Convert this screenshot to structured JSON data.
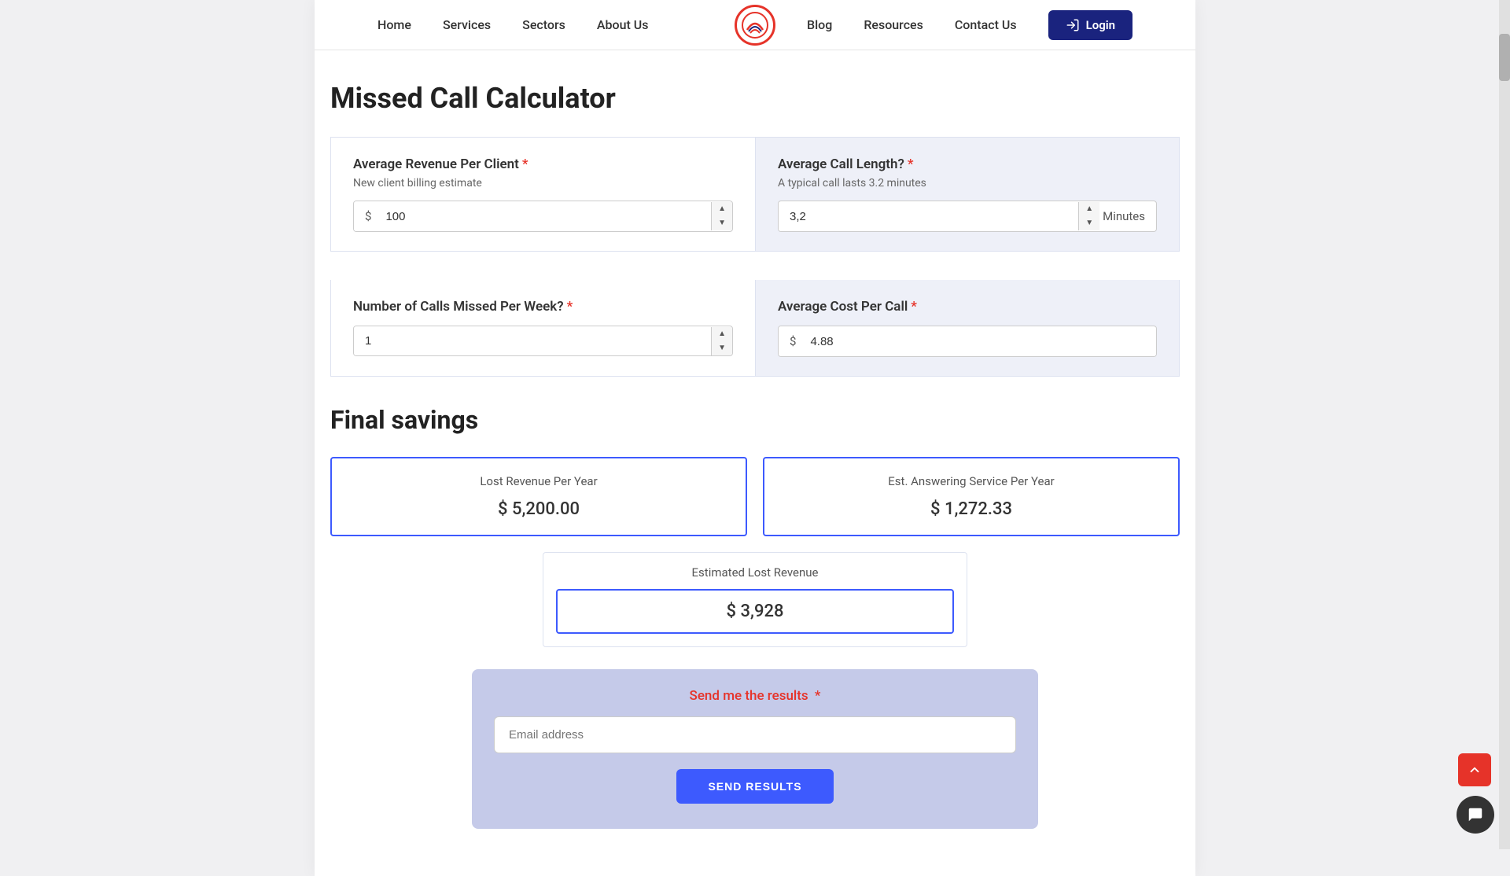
{
  "nav": {
    "links_left": [
      {
        "label": "Home",
        "id": "home"
      },
      {
        "label": "Services",
        "id": "services"
      },
      {
        "label": "Sectors",
        "id": "sectors"
      },
      {
        "label": "About Us",
        "id": "about-us"
      }
    ],
    "links_right": [
      {
        "label": "Blog",
        "id": "blog"
      },
      {
        "label": "Resources",
        "id": "resources"
      },
      {
        "label": "Contact Us",
        "id": "contact-us"
      }
    ],
    "login_label": "Login"
  },
  "calculator": {
    "title": "Missed Call Calculator",
    "avg_revenue": {
      "label": "Average Revenue Per Client",
      "hint": "New client billing estimate",
      "prefix": "$",
      "value": "100"
    },
    "avg_call_length": {
      "label": "Average Call Length?",
      "hint": "A typical call lasts 3.2 minutes",
      "value": "3,2",
      "suffix": "Minutes"
    },
    "calls_missed": {
      "label": "Number of Calls Missed Per Week?",
      "value": "1"
    },
    "avg_cost": {
      "label": "Average Cost Per Call",
      "prefix": "$",
      "value": "4.88"
    }
  },
  "final_savings": {
    "title": "Final savings",
    "lost_revenue": {
      "label": "Lost Revenue Per Year",
      "prefix": "$",
      "value": "5,200.00"
    },
    "answering_service": {
      "label": "Est. Answering Service Per Year",
      "prefix": "$",
      "value": "1,272.33"
    },
    "estimated_lost": {
      "label": "Estimated Lost Revenue",
      "prefix": "$",
      "value": "3,928"
    }
  },
  "send_results": {
    "label": "Send me the results",
    "required_star": "*",
    "email_placeholder": "Email address",
    "button_label": "SEND RESULTS"
  }
}
